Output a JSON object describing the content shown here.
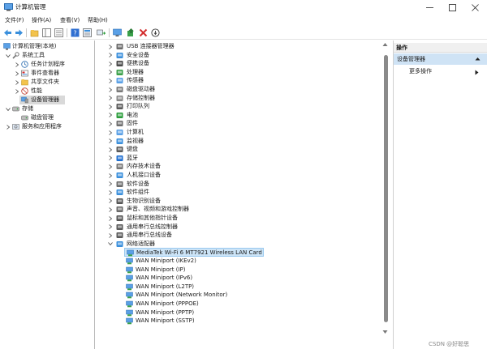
{
  "window": {
    "title": "计算机管理",
    "controls": [
      "minimize",
      "maximize",
      "close"
    ]
  },
  "menu": [
    "文件(F)",
    "操作(A)",
    "查看(V)",
    "帮助(H)"
  ],
  "toolbar": {
    "icons": [
      "back-icon",
      "forward-icon",
      "up-folder-icon",
      "console-tree-icon",
      "export-list-icon",
      "help-icon",
      "properties-icon",
      "scan-hardware-icon",
      "monitor-icon",
      "update-driver-icon",
      "uninstall-icon",
      "disable-device-icon"
    ]
  },
  "left_tree": {
    "root": "计算机管理(本地)",
    "system_tools": "系统工具",
    "task_scheduler": "任务计划程序",
    "event_viewer": "事件查看器",
    "shared_folders": "共享文件夹",
    "performance": "性能",
    "device_manager": "设备管理器",
    "storage": "存储",
    "disk_management": "磁盘管理",
    "services_apps": "服务和应用程序"
  },
  "device_categories": [
    "USB 连接器管理器",
    "安全设备",
    "便携设备",
    "处理器",
    "传感器",
    "磁盘驱动器",
    "存储控制器",
    "打印队列",
    "电池",
    "固件",
    "计算机",
    "监视器",
    "键盘",
    "蓝牙",
    "内存技术设备",
    "人机接口设备",
    "软件设备",
    "软件组件",
    "生物识别设备",
    "声音、视频和游戏控制器",
    "鼠标和其他指针设备",
    "通用串行总线控制器",
    "通用串行总线设备",
    "网络适配器"
  ],
  "network_adapters": [
    "MediaTek Wi-Fi 6 MT7921 Wireless LAN Card",
    "WAN Miniport (IKEv2)",
    "WAN Miniport (IP)",
    "WAN Miniport (IPv6)",
    "WAN Miniport (L2TP)",
    "WAN Miniport (Network Monitor)",
    "WAN Miniport (PPPOE)",
    "WAN Miniport (PPTP)",
    "WAN Miniport (SSTP)"
  ],
  "actions": {
    "header": "操作",
    "section": "设备管理器",
    "more": "更多操作"
  },
  "watermark": "CSDN @好聪思",
  "colors": {
    "selected_row": "#cce4f7",
    "selected_border": "#99c9ef",
    "actions_highlight": "#cfe3f5",
    "delete_red": "#d32f2f"
  }
}
